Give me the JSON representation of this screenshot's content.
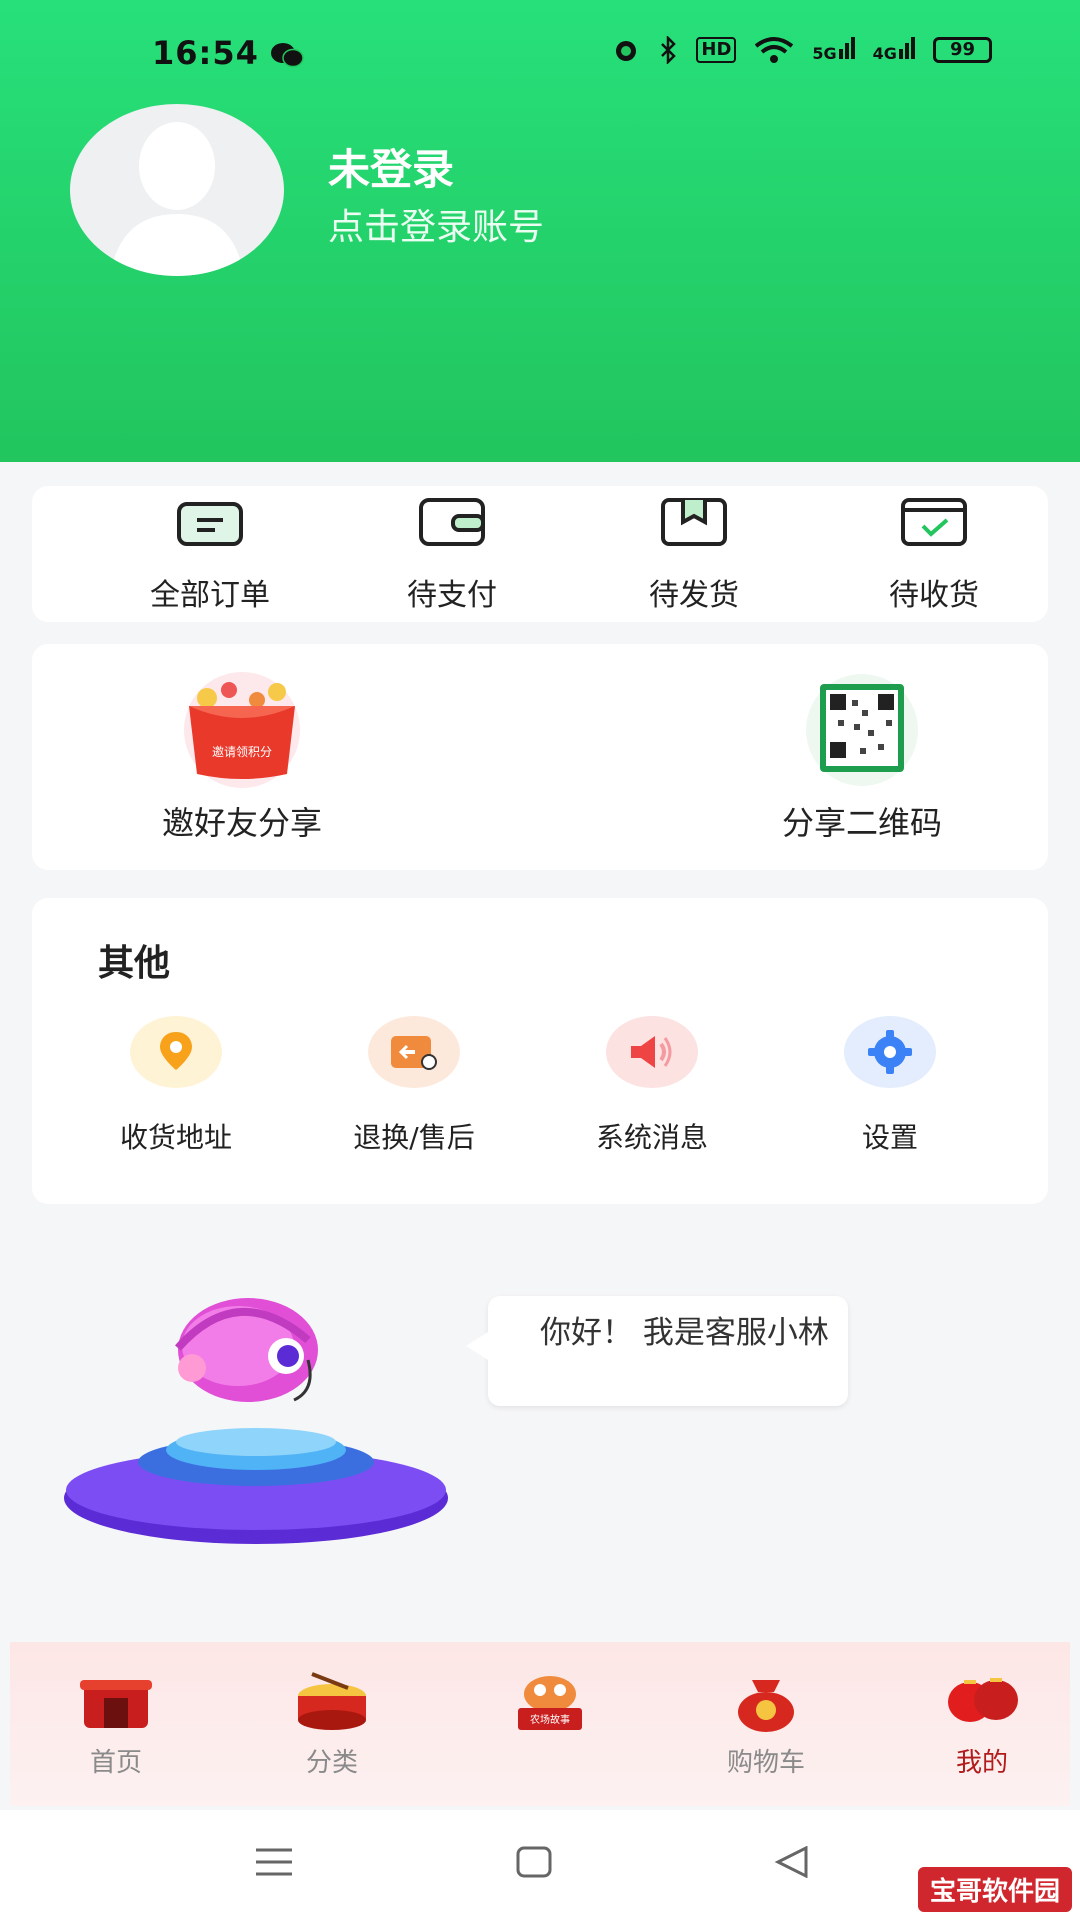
{
  "status": {
    "time": "16:54",
    "battery": "99",
    "signal_5g": "5G",
    "signal_4g": "4G",
    "hd": "HD"
  },
  "profile": {
    "name": "未登录",
    "subtitle": "点击登录账号"
  },
  "orders": [
    {
      "label": "全部订单",
      "icon": "order-list-icon"
    },
    {
      "label": "待支付",
      "icon": "wallet-icon"
    },
    {
      "label": "待发货",
      "icon": "package-icon"
    },
    {
      "label": "待收货",
      "icon": "received-icon"
    }
  ],
  "share": {
    "invite_label": "邀好友分享",
    "invite_badge": "邀请领积分",
    "qr_label": "分享二维码"
  },
  "other": {
    "title": "其他",
    "items": [
      {
        "label": "收货地址",
        "icon": "location-icon",
        "color": "#f7a21a"
      },
      {
        "label": "退换/售后",
        "icon": "return-icon",
        "color": "#f08a3c"
      },
      {
        "label": "系统消息",
        "icon": "speaker-icon",
        "color": "#ef4444"
      },
      {
        "label": "设置",
        "icon": "gear-icon",
        "color": "#3b82f6"
      }
    ]
  },
  "assistant": {
    "greeting": "你好！ 我是客服小林"
  },
  "tabbar": {
    "items": [
      {
        "label": "首页",
        "active": false
      },
      {
        "label": "分类",
        "active": false
      },
      {
        "label": "农场故事",
        "active": false
      },
      {
        "label": "购物车",
        "active": false
      },
      {
        "label": "我的",
        "active": true
      }
    ]
  },
  "watermark": "宝哥软件园",
  "colors": {
    "header_green": "#22c55e",
    "active_red": "#b11b1b"
  }
}
